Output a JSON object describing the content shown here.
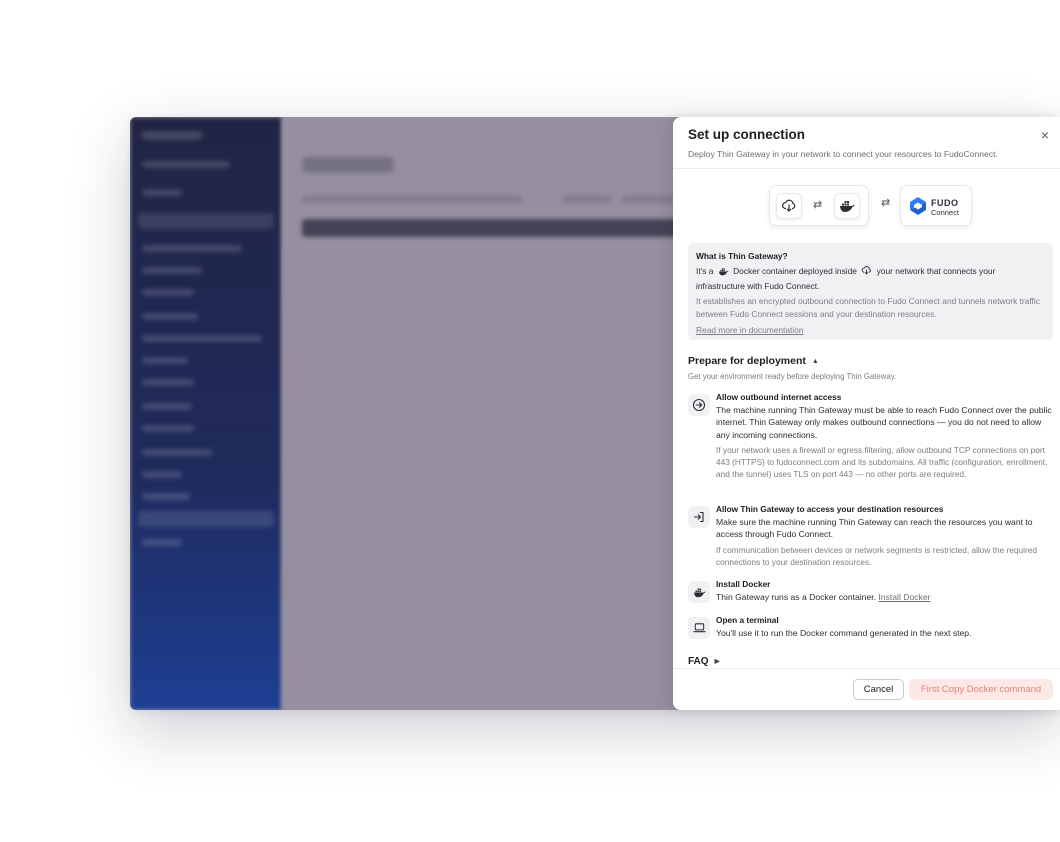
{
  "drawer": {
    "title": "Set up connection",
    "subtitle": "Deploy Thin Gateway in your network to connect your resources to FudoConnect.",
    "close_label": "×"
  },
  "diagram": {
    "arrow_symbol": "⇄",
    "brand_word": "FUDO",
    "brand_sub": "Connect",
    "icons": [
      "cloud-network-icon",
      "docker-icon",
      "fudo-connect-logo"
    ]
  },
  "info": {
    "title": "What is Thin Gateway?",
    "line_part1": "It's a",
    "line_part2": "Docker container deployed inside",
    "line_part3": "your network that connects your infrastructure with Fudo Connect.",
    "muted": "It establishes an encrypted outbound connection to Fudo Connect and tunnels network traffic between Fudo Connect sessions and your destination resources.",
    "link": "Read more in documentation"
  },
  "prepare": {
    "title": "Prepare for deployment",
    "caret": "▲",
    "subtitle": "Get your environment ready before deploying Thin Gateway.",
    "steps": [
      {
        "icon": "arrow-circle-right-icon",
        "title": "Allow outbound internet access",
        "text": "The machine running Thin Gateway must be able to reach Fudo Connect over the public internet. Thin Gateway only makes outbound connections — you do not need to allow any incoming connections.",
        "muted": "If your network uses a firewall or egress filtering, allow outbound TCP connections on port 443 (HTTPS) to fudoconnect.com and its subdomains. All traffic (configuration, enrollment, and the tunnel) uses TLS on port 443 — no other ports are required."
      },
      {
        "icon": "sign-in-icon",
        "title": "Allow Thin Gateway to access your destination resources",
        "text": "Make sure the machine running Thin Gateway can reach the resources you want to access through Fudo Connect.",
        "muted": "If communication between devices or network segments is restricted, allow the required connections to your destination resources."
      },
      {
        "icon": "docker-icon",
        "title": "Install Docker",
        "text": "Thin Gateway runs as a Docker container.",
        "link": "Install Docker"
      },
      {
        "icon": "laptop-icon",
        "title": "Open a terminal",
        "text": "You'll use it to run the Docker command generated in the next step."
      }
    ]
  },
  "faq": {
    "label": "FAQ",
    "caret": "▶"
  },
  "footer": {
    "cancel_label": "Cancel",
    "primary_label": "First Copy Docker command"
  },
  "colors": {
    "accent_soft_bg": "#fce8e4",
    "accent_text": "#e4857a",
    "brand_blue": "#2f7cf6",
    "overlay": "#9a95a6"
  }
}
